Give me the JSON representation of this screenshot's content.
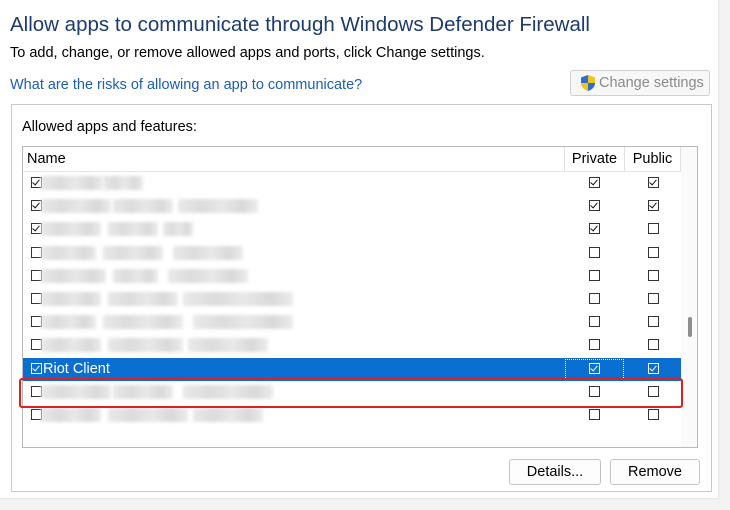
{
  "window": {
    "title": "Allow apps to communicate through Windows Defender Firewall",
    "subtitle": "To add, change, or remove allowed apps and ports, click Change settings.",
    "risk_link": "What are the risks of allowing an app to communicate?",
    "change_settings_label": "Change settings"
  },
  "allowed_apps": {
    "group_label": "Allowed apps and features:",
    "columns": {
      "name": "Name",
      "private": "Private",
      "public": "Public"
    },
    "rows": [
      {
        "name": "",
        "enabled": true,
        "private": true,
        "public": true,
        "obscured": true
      },
      {
        "name": "",
        "enabled": true,
        "private": true,
        "public": true,
        "obscured": true
      },
      {
        "name": "",
        "enabled": true,
        "private": true,
        "public": false,
        "obscured": true
      },
      {
        "name": "",
        "enabled": false,
        "private": false,
        "public": false,
        "obscured": true
      },
      {
        "name": "",
        "enabled": false,
        "private": false,
        "public": false,
        "obscured": true
      },
      {
        "name": "",
        "enabled": false,
        "private": false,
        "public": false,
        "obscured": true
      },
      {
        "name": "",
        "enabled": false,
        "private": false,
        "public": false,
        "obscured": true
      },
      {
        "name": "",
        "enabled": false,
        "private": false,
        "public": false,
        "obscured": true
      },
      {
        "name": "Riot Client",
        "enabled": true,
        "private": true,
        "public": true,
        "selected": true
      },
      {
        "name": "",
        "enabled": false,
        "private": false,
        "public": false,
        "obscured": true
      },
      {
        "name": "",
        "enabled": false,
        "private": false,
        "public": false,
        "obscured": true
      }
    ]
  },
  "buttons": {
    "details": "Details...",
    "remove": "Remove"
  },
  "colors": {
    "title": "#1c3b6e",
    "link": "#1a5fb4",
    "selection": "#0a6fd0",
    "highlight_box": "#e02020"
  }
}
